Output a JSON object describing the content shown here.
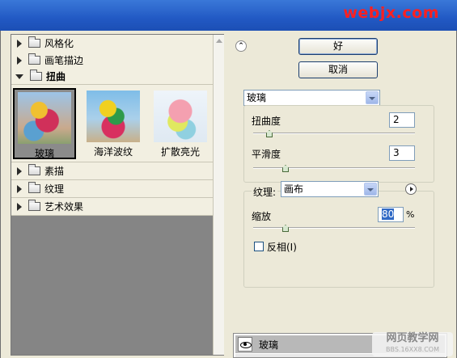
{
  "watermark_top": "webjx.com",
  "gallery": {
    "categories_top": [
      {
        "label": "风格化",
        "expanded": false
      },
      {
        "label": "画笔描边",
        "expanded": false
      },
      {
        "label": "扭曲",
        "expanded": true
      }
    ],
    "thumbnails": [
      {
        "label": "玻璃",
        "selected": true
      },
      {
        "label": "海洋波纹",
        "selected": false
      },
      {
        "label": "扩散亮光",
        "selected": false
      }
    ],
    "categories_bottom": [
      {
        "label": "素描",
        "expanded": false
      },
      {
        "label": "纹理",
        "expanded": false
      },
      {
        "label": "艺术效果",
        "expanded": false
      }
    ]
  },
  "buttons": {
    "ok": "好",
    "cancel": "取消"
  },
  "filter_select": "玻璃",
  "params": {
    "distortion": {
      "label": "扭曲度",
      "value": "2",
      "level": 0.1
    },
    "smoothness": {
      "label": "平滑度",
      "value": "3",
      "level": 0.2
    },
    "texture": {
      "label": "纹理:",
      "value": "画布"
    },
    "scaling": {
      "label": "缩放",
      "value": "80",
      "unit": "%",
      "level": 0.2
    },
    "invert": {
      "label": "反相(I)",
      "checked": false
    }
  },
  "layer": {
    "name": "玻璃"
  },
  "watermark_bottom": {
    "line1": "网页教学网",
    "line2": "BBS.16XX8.COM"
  }
}
